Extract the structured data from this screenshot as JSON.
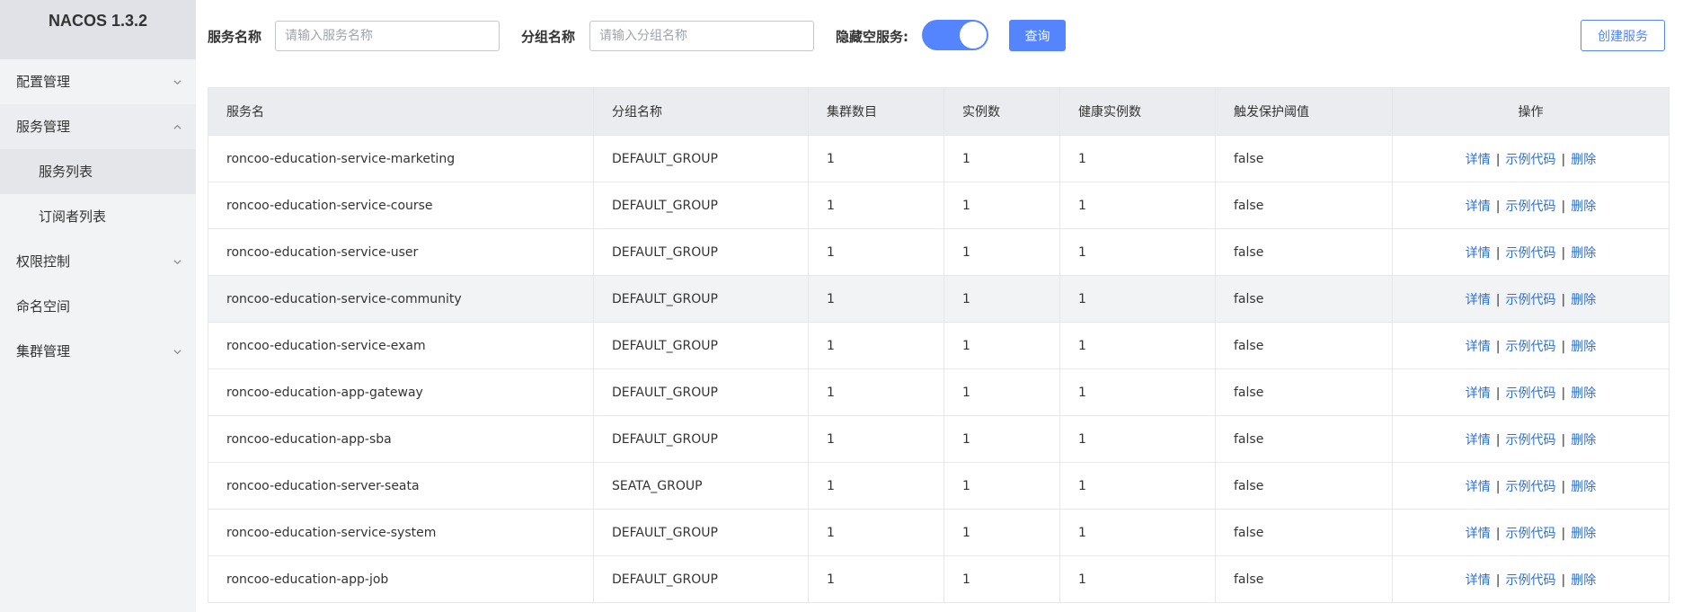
{
  "brand": {
    "title": "NACOS 1.3.2"
  },
  "sidebar": {
    "items": [
      {
        "label": "配置管理"
      },
      {
        "label": "服务管理"
      },
      {
        "label": "服务列表"
      },
      {
        "label": "订阅者列表"
      },
      {
        "label": "权限控制"
      },
      {
        "label": "命名空间"
      },
      {
        "label": "集群管理"
      }
    ]
  },
  "toolbar": {
    "service_name_label": "服务名称",
    "service_name_placeholder": "请输入服务名称",
    "group_name_label": "分组名称",
    "group_name_placeholder": "请输入分组名称",
    "hide_empty_label": "隐藏空服务:",
    "hide_empty_on": true,
    "query_label": "查询",
    "create_label": "创建服务"
  },
  "table": {
    "headers": [
      "服务名",
      "分组名称",
      "集群数目",
      "实例数",
      "健康实例数",
      "触发保护阈值",
      "操作"
    ],
    "actions": {
      "detail": "详情",
      "sample": "示例代码",
      "delete": "删除",
      "separator": "|"
    },
    "rows": [
      [
        "roncoo-education-service-marketing",
        "DEFAULT_GROUP",
        "1",
        "1",
        "1",
        "false"
      ],
      [
        "roncoo-education-service-course",
        "DEFAULT_GROUP",
        "1",
        "1",
        "1",
        "false"
      ],
      [
        "roncoo-education-service-user",
        "DEFAULT_GROUP",
        "1",
        "1",
        "1",
        "false"
      ],
      [
        "roncoo-education-service-community",
        "DEFAULT_GROUP",
        "1",
        "1",
        "1",
        "false"
      ],
      [
        "roncoo-education-service-exam",
        "DEFAULT_GROUP",
        "1",
        "1",
        "1",
        "false"
      ],
      [
        "roncoo-education-app-gateway",
        "DEFAULT_GROUP",
        "1",
        "1",
        "1",
        "false"
      ],
      [
        "roncoo-education-app-sba",
        "DEFAULT_GROUP",
        "1",
        "1",
        "1",
        "false"
      ],
      [
        "roncoo-education-server-seata",
        "SEATA_GROUP",
        "1",
        "1",
        "1",
        "false"
      ],
      [
        "roncoo-education-service-system",
        "DEFAULT_GROUP",
        "1",
        "1",
        "1",
        "false"
      ],
      [
        "roncoo-education-app-job",
        "DEFAULT_GROUP",
        "1",
        "1",
        "1",
        "false"
      ]
    ]
  },
  "colors": {
    "accent": "#5584ff",
    "link": "#2f6fd6",
    "sidebar_bg": "#f2f3f5",
    "header_bg": "#ebecf0"
  }
}
